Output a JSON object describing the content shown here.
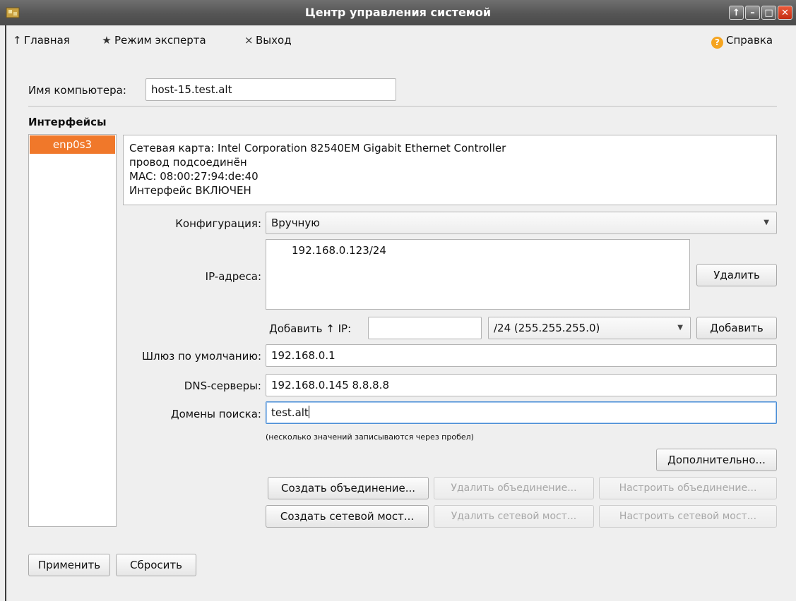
{
  "window": {
    "title": "Центр управления системой",
    "controls": [
      "↑",
      "–",
      "□",
      "✕"
    ]
  },
  "toolbar": {
    "home": {
      "icon": "↑",
      "label": "Главная"
    },
    "expert": {
      "icon": "★",
      "label": "Режим эксперта"
    },
    "exit": {
      "icon": "×",
      "label": "Выход"
    },
    "help": {
      "icon": "?",
      "label": "Справка"
    }
  },
  "hostname": {
    "label": "Имя компьютера:",
    "value": "host-15.test.alt"
  },
  "interfaces": {
    "heading": "Интерфейсы",
    "items": [
      "enp0s3"
    ],
    "selected_color": "#f0782a",
    "info": [
      "Сетевая карта: Intel Corporation 82540EM Gigabit Ethernet Controller",
      "провод подсоединён",
      "MAC: 08:00:27:94:de:40",
      "Интерфейс ВКЛЮЧЕН"
    ]
  },
  "config": {
    "label": "Конфигурация:",
    "value": "Вручную"
  },
  "ip": {
    "label": "IP-адреса:",
    "addresses": [
      "192.168.0.123/24"
    ],
    "remove_label": "Удалить",
    "add_label": "Добавить ↑ IP:",
    "add_value": "",
    "mask_value": "/24 (255.255.255.0)",
    "add_button": "Добавить"
  },
  "gateway": {
    "label": "Шлюз по умолчанию:",
    "value": "192.168.0.1"
  },
  "dns": {
    "label": "DNS-серверы:",
    "value": "192.168.0.145 8.8.8.8"
  },
  "search": {
    "label": "Домены поиска:",
    "value": "test.alt"
  },
  "hint": "(несколько значений записываются через пробел)",
  "buttons": {
    "advanced": "Дополнительно...",
    "create_bond": "Создать объединение...",
    "delete_bond": "Удалить объединение...",
    "configure_bond": "Настроить объединение...",
    "create_bridge": "Создать сетевой мост...",
    "delete_bridge": "Удалить сетевой мост...",
    "configure_bridge": "Настроить сетевой мост...",
    "apply": "Применить",
    "reset": "Сбросить"
  }
}
